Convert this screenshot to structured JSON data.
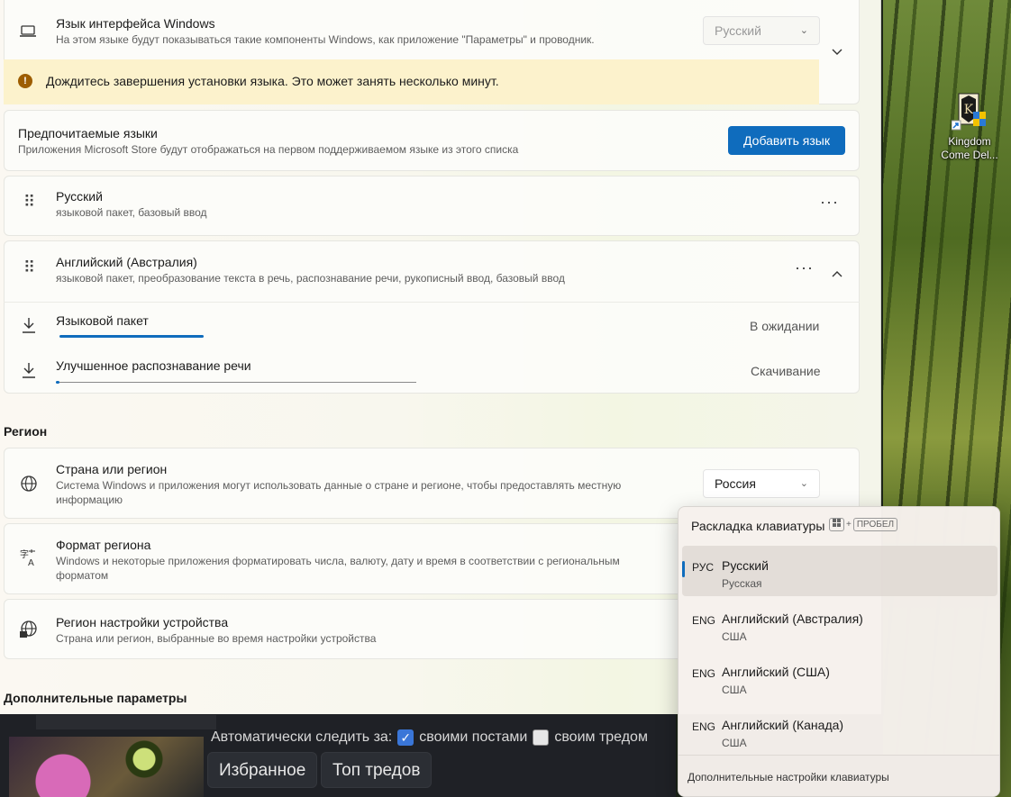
{
  "settings": {
    "display_lang": {
      "title": "Язык интерфейса Windows",
      "subtitle": "На этом языке будут показываться такие компоненты Windows, как приложение \"Параметры\" и проводник.",
      "value": "Русский"
    },
    "warning": {
      "text": "Дождитесь завершения установки языка. Это может занять несколько минут."
    },
    "preferred": {
      "title": "Предпочитаемые языки",
      "subtitle": "Приложения Microsoft Store будут отображаться на первом поддерживаемом языке из этого списка",
      "add_button": "Добавить язык"
    },
    "languages": [
      {
        "name": "Русский",
        "features": "языковой пакет, базовый ввод"
      },
      {
        "name": "Английский (Австралия)",
        "features": "языковой пакет, преобразование текста в речь, распознавание речи, рукописный ввод, базовый ввод"
      }
    ],
    "downloads": [
      {
        "label": "Языковой пакет",
        "status": "В ожидании",
        "progress": 0.4
      },
      {
        "label": "Улучшенное распознавание речи",
        "status": "Скачивание",
        "progress": 0.01
      }
    ],
    "region_header": "Регион",
    "country": {
      "title": "Страна или регион",
      "subtitle": "Система Windows и приложения могут использовать данные о стране и регионе, чтобы предоставлять местную информацию",
      "value": "Россия"
    },
    "format": {
      "title": "Формат региона",
      "subtitle": "Windows и некоторые приложения форматировать числа, валюту, дату и время в соответствии с региональным форматом"
    },
    "setup_region": {
      "title": "Регион настройки устройства",
      "subtitle": "Страна или регион, выбранные во время настройки устройства"
    },
    "advanced_header": "Дополнительные параметры"
  },
  "flyout": {
    "title": "Раскладка клавиатуры",
    "shortcut_plus": "+",
    "shortcut_key": "ПРОБЕЛ",
    "items": [
      {
        "code": "РУС",
        "name": "Русский",
        "layout": "Русская",
        "selected": true
      },
      {
        "code": "ENG",
        "name": "Английский (Австралия)",
        "layout": "США",
        "selected": false
      },
      {
        "code": "ENG",
        "name": "Английский (США)",
        "layout": "США",
        "selected": false
      },
      {
        "code": "ENG",
        "name": "Английский (Канада)",
        "layout": "США",
        "selected": false
      }
    ],
    "footer": "Дополнительные настройки клавиатуры"
  },
  "browser": {
    "auto_watch": "Автоматически следить за:",
    "own_posts": "своими постами",
    "own_posts_checked": true,
    "own_thread": "своим тредом",
    "own_thread_checked": false,
    "favorites": "Избранное",
    "top_threads": "Топ тредов"
  },
  "desktop": {
    "icon_label": "Kingdom Come Del..."
  },
  "colors": {
    "accent": "#0f6cbd",
    "warning_bg": "#fcf2cc"
  }
}
